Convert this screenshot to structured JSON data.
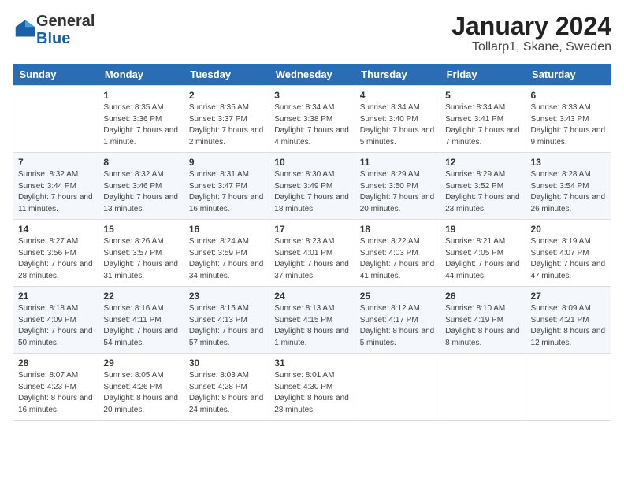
{
  "logo": {
    "general": "General",
    "blue": "Blue"
  },
  "title": "January 2024",
  "subtitle": "Tollarp1, Skane, Sweden",
  "weekdays": [
    "Sunday",
    "Monday",
    "Tuesday",
    "Wednesday",
    "Thursday",
    "Friday",
    "Saturday"
  ],
  "weeks": [
    [
      {
        "day": "",
        "sunrise": "",
        "sunset": "",
        "daylight": ""
      },
      {
        "day": "1",
        "sunrise": "Sunrise: 8:35 AM",
        "sunset": "Sunset: 3:36 PM",
        "daylight": "Daylight: 7 hours and 1 minute."
      },
      {
        "day": "2",
        "sunrise": "Sunrise: 8:35 AM",
        "sunset": "Sunset: 3:37 PM",
        "daylight": "Daylight: 7 hours and 2 minutes."
      },
      {
        "day": "3",
        "sunrise": "Sunrise: 8:34 AM",
        "sunset": "Sunset: 3:38 PM",
        "daylight": "Daylight: 7 hours and 4 minutes."
      },
      {
        "day": "4",
        "sunrise": "Sunrise: 8:34 AM",
        "sunset": "Sunset: 3:40 PM",
        "daylight": "Daylight: 7 hours and 5 minutes."
      },
      {
        "day": "5",
        "sunrise": "Sunrise: 8:34 AM",
        "sunset": "Sunset: 3:41 PM",
        "daylight": "Daylight: 7 hours and 7 minutes."
      },
      {
        "day": "6",
        "sunrise": "Sunrise: 8:33 AM",
        "sunset": "Sunset: 3:43 PM",
        "daylight": "Daylight: 7 hours and 9 minutes."
      }
    ],
    [
      {
        "day": "7",
        "sunrise": "Sunrise: 8:32 AM",
        "sunset": "Sunset: 3:44 PM",
        "daylight": "Daylight: 7 hours and 11 minutes."
      },
      {
        "day": "8",
        "sunrise": "Sunrise: 8:32 AM",
        "sunset": "Sunset: 3:46 PM",
        "daylight": "Daylight: 7 hours and 13 minutes."
      },
      {
        "day": "9",
        "sunrise": "Sunrise: 8:31 AM",
        "sunset": "Sunset: 3:47 PM",
        "daylight": "Daylight: 7 hours and 16 minutes."
      },
      {
        "day": "10",
        "sunrise": "Sunrise: 8:30 AM",
        "sunset": "Sunset: 3:49 PM",
        "daylight": "Daylight: 7 hours and 18 minutes."
      },
      {
        "day": "11",
        "sunrise": "Sunrise: 8:29 AM",
        "sunset": "Sunset: 3:50 PM",
        "daylight": "Daylight: 7 hours and 20 minutes."
      },
      {
        "day": "12",
        "sunrise": "Sunrise: 8:29 AM",
        "sunset": "Sunset: 3:52 PM",
        "daylight": "Daylight: 7 hours and 23 minutes."
      },
      {
        "day": "13",
        "sunrise": "Sunrise: 8:28 AM",
        "sunset": "Sunset: 3:54 PM",
        "daylight": "Daylight: 7 hours and 26 minutes."
      }
    ],
    [
      {
        "day": "14",
        "sunrise": "Sunrise: 8:27 AM",
        "sunset": "Sunset: 3:56 PM",
        "daylight": "Daylight: 7 hours and 28 minutes."
      },
      {
        "day": "15",
        "sunrise": "Sunrise: 8:26 AM",
        "sunset": "Sunset: 3:57 PM",
        "daylight": "Daylight: 7 hours and 31 minutes."
      },
      {
        "day": "16",
        "sunrise": "Sunrise: 8:24 AM",
        "sunset": "Sunset: 3:59 PM",
        "daylight": "Daylight: 7 hours and 34 minutes."
      },
      {
        "day": "17",
        "sunrise": "Sunrise: 8:23 AM",
        "sunset": "Sunset: 4:01 PM",
        "daylight": "Daylight: 7 hours and 37 minutes."
      },
      {
        "day": "18",
        "sunrise": "Sunrise: 8:22 AM",
        "sunset": "Sunset: 4:03 PM",
        "daylight": "Daylight: 7 hours and 41 minutes."
      },
      {
        "day": "19",
        "sunrise": "Sunrise: 8:21 AM",
        "sunset": "Sunset: 4:05 PM",
        "daylight": "Daylight: 7 hours and 44 minutes."
      },
      {
        "day": "20",
        "sunrise": "Sunrise: 8:19 AM",
        "sunset": "Sunset: 4:07 PM",
        "daylight": "Daylight: 7 hours and 47 minutes."
      }
    ],
    [
      {
        "day": "21",
        "sunrise": "Sunrise: 8:18 AM",
        "sunset": "Sunset: 4:09 PM",
        "daylight": "Daylight: 7 hours and 50 minutes."
      },
      {
        "day": "22",
        "sunrise": "Sunrise: 8:16 AM",
        "sunset": "Sunset: 4:11 PM",
        "daylight": "Daylight: 7 hours and 54 minutes."
      },
      {
        "day": "23",
        "sunrise": "Sunrise: 8:15 AM",
        "sunset": "Sunset: 4:13 PM",
        "daylight": "Daylight: 7 hours and 57 minutes."
      },
      {
        "day": "24",
        "sunrise": "Sunrise: 8:13 AM",
        "sunset": "Sunset: 4:15 PM",
        "daylight": "Daylight: 8 hours and 1 minute."
      },
      {
        "day": "25",
        "sunrise": "Sunrise: 8:12 AM",
        "sunset": "Sunset: 4:17 PM",
        "daylight": "Daylight: 8 hours and 5 minutes."
      },
      {
        "day": "26",
        "sunrise": "Sunrise: 8:10 AM",
        "sunset": "Sunset: 4:19 PM",
        "daylight": "Daylight: 8 hours and 8 minutes."
      },
      {
        "day": "27",
        "sunrise": "Sunrise: 8:09 AM",
        "sunset": "Sunset: 4:21 PM",
        "daylight": "Daylight: 8 hours and 12 minutes."
      }
    ],
    [
      {
        "day": "28",
        "sunrise": "Sunrise: 8:07 AM",
        "sunset": "Sunset: 4:23 PM",
        "daylight": "Daylight: 8 hours and 16 minutes."
      },
      {
        "day": "29",
        "sunrise": "Sunrise: 8:05 AM",
        "sunset": "Sunset: 4:26 PM",
        "daylight": "Daylight: 8 hours and 20 minutes."
      },
      {
        "day": "30",
        "sunrise": "Sunrise: 8:03 AM",
        "sunset": "Sunset: 4:28 PM",
        "daylight": "Daylight: 8 hours and 24 minutes."
      },
      {
        "day": "31",
        "sunrise": "Sunrise: 8:01 AM",
        "sunset": "Sunset: 4:30 PM",
        "daylight": "Daylight: 8 hours and 28 minutes."
      },
      {
        "day": "",
        "sunrise": "",
        "sunset": "",
        "daylight": ""
      },
      {
        "day": "",
        "sunrise": "",
        "sunset": "",
        "daylight": ""
      },
      {
        "day": "",
        "sunrise": "",
        "sunset": "",
        "daylight": ""
      }
    ]
  ]
}
